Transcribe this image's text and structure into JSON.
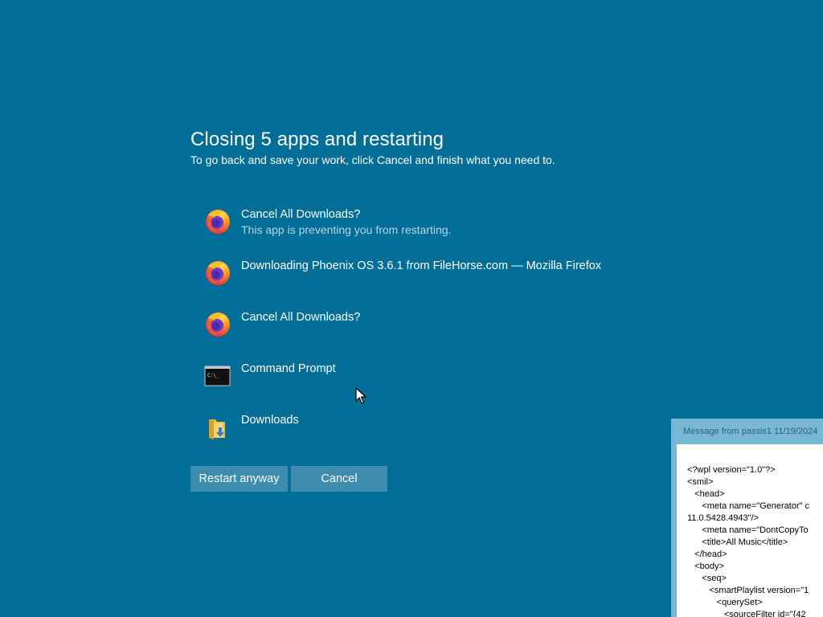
{
  "dialog": {
    "title": "Closing 5 apps and restarting",
    "subtitle": "To go back and save your work, click Cancel and finish what you need to."
  },
  "apps": [
    {
      "name": "Cancel All Downloads?",
      "note": "This app is preventing you from restarting.",
      "icon": "firefox-icon"
    },
    {
      "name": "Downloading Phoenix OS 3.6.1 from FileHorse.com — Mozilla Firefox",
      "note": "",
      "icon": "firefox-icon"
    },
    {
      "name": "Cancel All Downloads?",
      "note": "",
      "icon": "firefox-icon"
    },
    {
      "name": "Command Prompt",
      "note": "",
      "icon": "command-prompt-icon"
    },
    {
      "name": "Downloads",
      "note": "",
      "icon": "downloads-folder-icon"
    }
  ],
  "buttons": {
    "restart": "Restart anyway",
    "cancel": "Cancel"
  },
  "cmd_icon_text": "C:\\_",
  "message_window": {
    "title": "Message from passis1 11/19/2024",
    "content": "<?wpl version=\"1.0\"?>\n<smil>\n   <head>\n      <meta name=\"Generator\" c\n11.0.5428.4943\"/>\n      <meta name=\"DontCopyTo\n      <title>All Music</title>\n   </head>\n   <body>\n      <seq>\n         <smartPlaylist version=\"1\n            <querySet>\n               <sourceFilter id=\"{42"
  },
  "colors": {
    "background": "#006e96",
    "button": "#3d8cae",
    "secondary_text": "#b5d6e4",
    "message_titlebar": "#78b8d6"
  }
}
